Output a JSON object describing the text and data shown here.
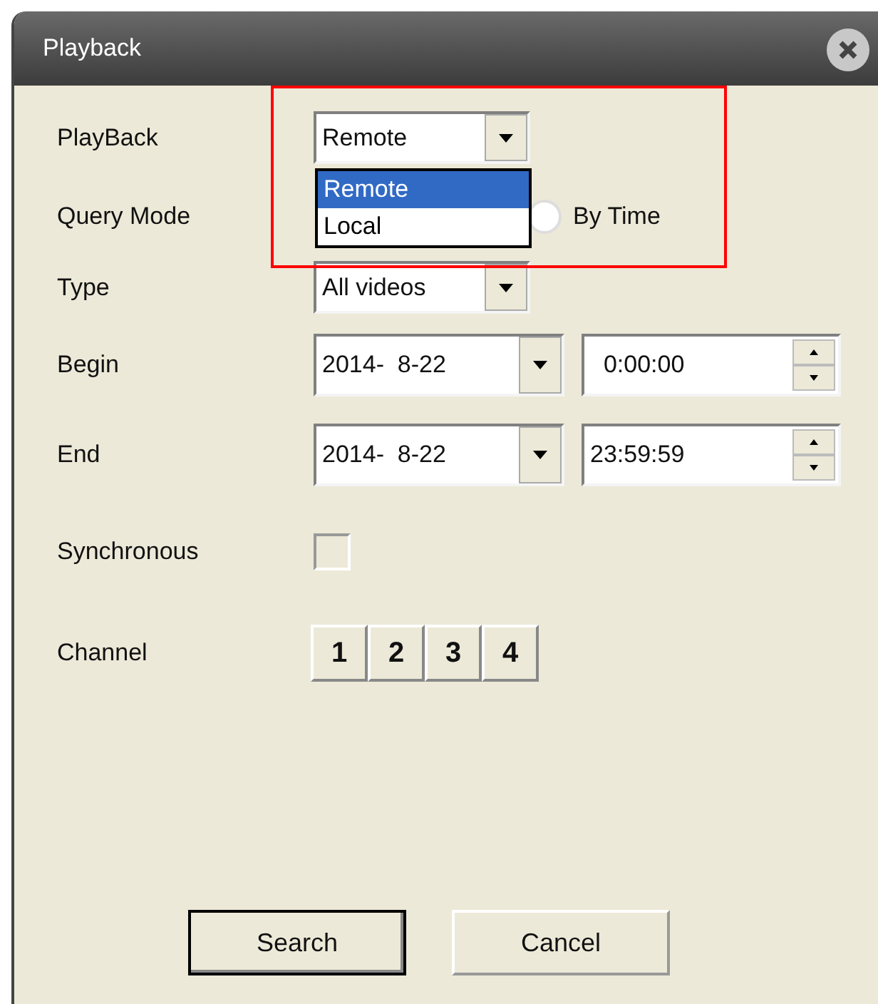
{
  "window": {
    "title": "Playback"
  },
  "playback": {
    "label": "PlayBack",
    "value": "Remote",
    "expanded": true,
    "options": [
      {
        "label": "Remote",
        "selected": true
      },
      {
        "label": "Local",
        "selected": false
      }
    ]
  },
  "query_mode": {
    "label": "Query Mode",
    "radio": {
      "label": "By Time",
      "selected": false
    }
  },
  "type": {
    "label": "Type",
    "value": "All videos"
  },
  "begin": {
    "label": "Begin",
    "date": "2014-  8-22",
    "time": "  0:00:00"
  },
  "end": {
    "label": "End",
    "date": "2014-  8-22",
    "time": "23:59:59"
  },
  "synchronous": {
    "label": "Synchronous",
    "checked": false
  },
  "channel": {
    "label": "Channel",
    "buttons": [
      "1",
      "2",
      "3",
      "4"
    ]
  },
  "buttons": [
    {
      "label": "Search",
      "default": true
    },
    {
      "label": "Cancel",
      "default": false
    }
  ]
}
